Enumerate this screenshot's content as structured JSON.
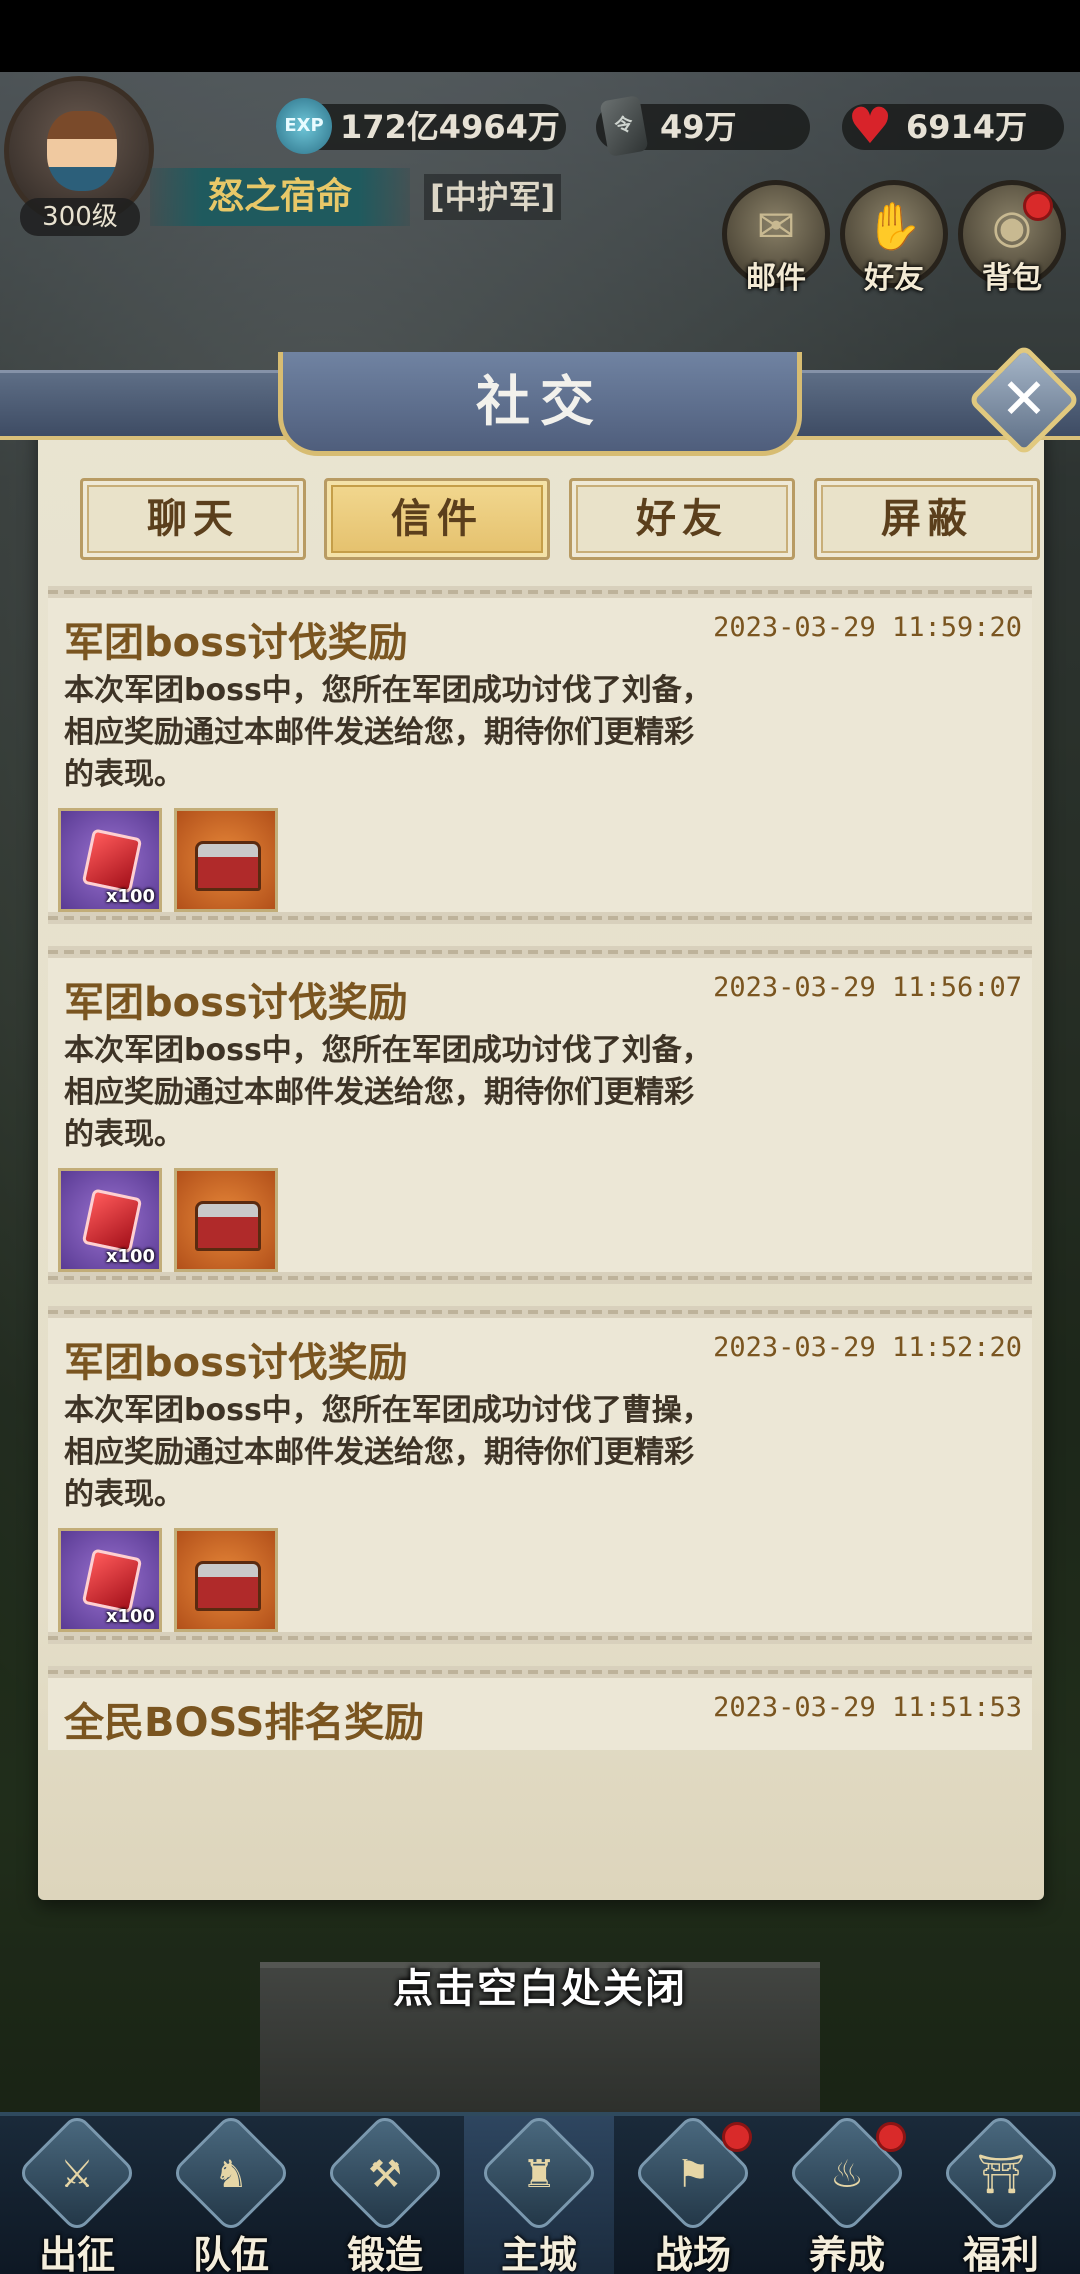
{
  "hud": {
    "level": "300级",
    "exp_value": "172亿4964万",
    "ticket_value": "49万",
    "hearts_value": "6914万",
    "player_name": "怒之宿命",
    "rank_tag": "[中护军]",
    "shortcuts": [
      {
        "label": "邮件",
        "icon": "mail-scroll-icon"
      },
      {
        "label": "好友",
        "icon": "handshake-icon"
      },
      {
        "label": "背包",
        "icon": "bag-icon"
      }
    ]
  },
  "panel": {
    "title": "社交",
    "tabs": [
      {
        "label": "聊天",
        "active": false
      },
      {
        "label": "信件",
        "active": true
      },
      {
        "label": "好友",
        "active": false
      },
      {
        "label": "屏蔽",
        "active": false
      }
    ],
    "mails": [
      {
        "title": "军团boss讨伐奖励",
        "time": "2023-03-29 11:59:20",
        "body_lines": [
          "本次军团boss中，您所在军团成功讨伐了刘备，",
          "相应奖励通过本邮件发送给您，期待你们更精彩",
          "的表现。"
        ],
        "rewards": [
          {
            "icon": "red-gem-icon",
            "qty": "x100"
          },
          {
            "icon": "treasure-chest-icon",
            "qty": ""
          }
        ]
      },
      {
        "title": "军团boss讨伐奖励",
        "time": "2023-03-29 11:56:07",
        "body_lines": [
          "本次军团boss中，您所在军团成功讨伐了刘备，",
          "相应奖励通过本邮件发送给您，期待你们更精彩",
          "的表现。"
        ],
        "rewards": [
          {
            "icon": "red-gem-icon",
            "qty": "x100"
          },
          {
            "icon": "treasure-chest-icon",
            "qty": ""
          }
        ]
      },
      {
        "title": "军团boss讨伐奖励",
        "time": "2023-03-29 11:52:20",
        "body_lines": [
          "本次军团boss中，您所在军团成功讨伐了曹操，",
          "相应奖励通过本邮件发送给您，期待你们更精彩",
          "的表现。"
        ],
        "rewards": [
          {
            "icon": "red-gem-icon",
            "qty": "x100"
          },
          {
            "icon": "treasure-chest-icon",
            "qty": ""
          }
        ]
      },
      {
        "title": "全民BOSS排名奖励",
        "time": "2023-03-29 11:51:53",
        "body_lines": [],
        "rewards": []
      }
    ],
    "close_hint": "点击空白处关闭"
  },
  "bottom_nav": [
    {
      "label": "出征",
      "icon": "crossed-swords-icon",
      "badge": false,
      "active": false
    },
    {
      "label": "队伍",
      "icon": "helmet-icon",
      "badge": false,
      "active": false
    },
    {
      "label": "锻造",
      "icon": "anvil-icon",
      "badge": false,
      "active": false
    },
    {
      "label": "主城",
      "icon": "castle-icon",
      "badge": false,
      "active": true
    },
    {
      "label": "战场",
      "icon": "battle-flag-icon",
      "badge": true,
      "active": false
    },
    {
      "label": "养成",
      "icon": "cauldron-icon",
      "badge": true,
      "active": false
    },
    {
      "label": "福利",
      "icon": "gift-pavilion-icon",
      "badge": false,
      "active": false
    }
  ]
}
